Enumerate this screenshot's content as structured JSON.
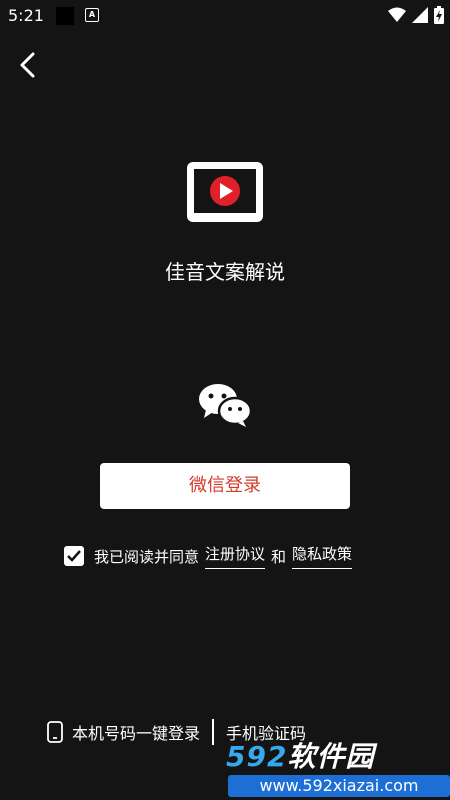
{
  "status_bar": {
    "time": "5:21",
    "notif_letter": "A"
  },
  "app": {
    "name": "佳音文案解说"
  },
  "login": {
    "wechat_button": "微信登录"
  },
  "agreement": {
    "prefix": "我已阅读并同意",
    "terms": "注册协议",
    "and": "和",
    "privacy": "隐私政策",
    "checked": true
  },
  "bottom": {
    "phone_login": "本机号码一键登录",
    "sms_login": "手机验证码"
  },
  "watermark": {
    "brand_num": "592",
    "brand_text": "软件园",
    "url": "www.592xiazai.com"
  },
  "colors": {
    "background": "#141414",
    "wechat_button_text": "#d33b2c",
    "logo_red": "#e0202a"
  }
}
